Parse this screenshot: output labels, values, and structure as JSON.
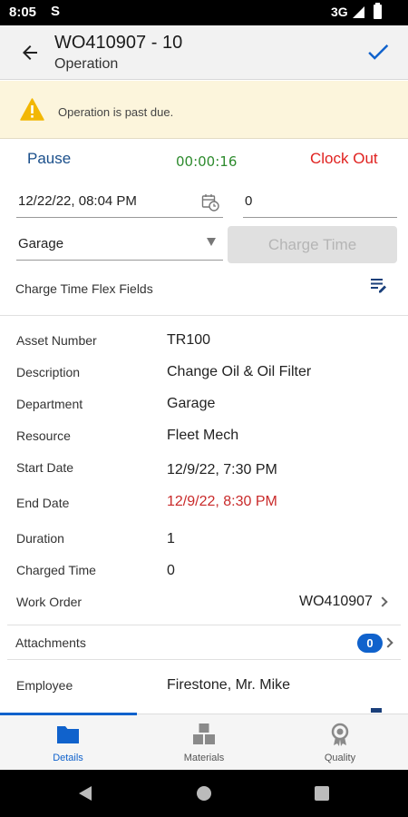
{
  "status_bar": {
    "time": "8:05",
    "network": "3G",
    "app_icon": "S"
  },
  "header": {
    "title": "WO410907 - 10",
    "subtitle": "Operation"
  },
  "warning": {
    "message": "Operation is past due."
  },
  "clock": {
    "pause_label": "Pause",
    "timer": "00:00:16",
    "clock_out_label": "Clock Out"
  },
  "charge_form": {
    "date_value": "12/22/22, 08:04 PM",
    "quantity_value": "0",
    "department_value": "Garage",
    "charge_time_label": "Charge Time"
  },
  "flex_fields": {
    "label": "Charge Time Flex Fields"
  },
  "details": [
    {
      "label": "Asset Number",
      "value": "TR100"
    },
    {
      "label": "Description",
      "value": "Change Oil & Oil Filter"
    },
    {
      "label": "Department",
      "value": "Garage"
    },
    {
      "label": "Resource",
      "value": "Fleet Mech"
    },
    {
      "label": "Start Date",
      "value": "12/9/22, 7:30 PM"
    },
    {
      "label": "End Date",
      "value": "12/9/22, 8:30 PM"
    },
    {
      "label": "Duration",
      "value": "1"
    },
    {
      "label": "Charged Time",
      "value": "0"
    }
  ],
  "work_order": {
    "label": "Work Order",
    "value": "WO410907"
  },
  "attachments": {
    "label": "Attachments",
    "count": "0"
  },
  "employee": {
    "label": "Employee",
    "value": "Firestone, Mr. Mike"
  },
  "bottom_nav": [
    {
      "label": "Details",
      "icon": "folder-icon"
    },
    {
      "label": "Materials",
      "icon": "boxes-icon"
    },
    {
      "label": "Quality",
      "icon": "award-icon"
    }
  ],
  "colors": {
    "accent": "#1062cc",
    "clock_out": "#e0211f",
    "timer": "#2e8b2e",
    "overdue_date": "#c92a2a",
    "warning_bg": "#fcf5dc"
  }
}
